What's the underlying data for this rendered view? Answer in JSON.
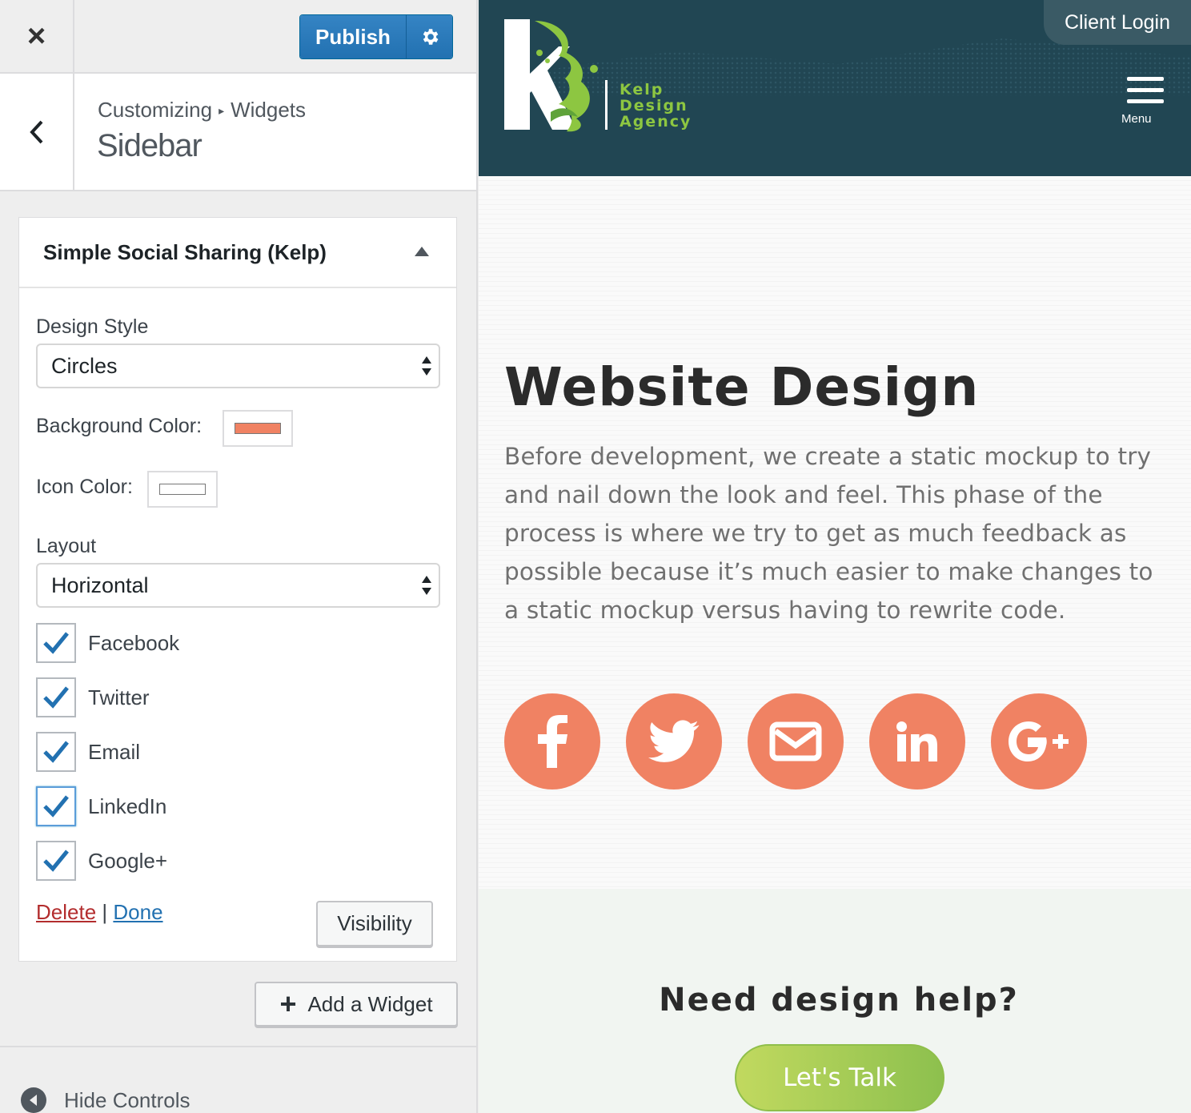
{
  "customizer": {
    "close_label": "×",
    "publish_label": "Publish",
    "breadcrumb": {
      "part1": "Customizing",
      "separator": "▸",
      "part2": "Widgets"
    },
    "section_title": "Sidebar",
    "widget": {
      "title": "Simple Social Sharing (Kelp)",
      "design_style": {
        "label": "Design Style",
        "value": "Circles"
      },
      "background_color": {
        "label": "Background Color:",
        "value": "#f08263"
      },
      "icon_color": {
        "label": "Icon Color:",
        "value": "#ffffff"
      },
      "layout": {
        "label": "Layout",
        "value": "Horizontal"
      },
      "networks": [
        {
          "label": "Facebook",
          "checked": true
        },
        {
          "label": "Twitter",
          "checked": true
        },
        {
          "label": "Email",
          "checked": true
        },
        {
          "label": "LinkedIn",
          "checked": true
        },
        {
          "label": "Google+",
          "checked": true
        }
      ],
      "delete_label": "Delete",
      "divider": "|",
      "done_label": "Done",
      "visibility_label": "Visibility"
    },
    "add_widget_label": "Add a Widget",
    "hide_controls_label": "Hide Controls"
  },
  "preview": {
    "client_login": "Client Login",
    "logo_text": [
      "Kelp",
      "Design",
      "Agency"
    ],
    "menu_label": "Menu",
    "heading": "Website Design",
    "paragraph": "Before development, we create a static mockup to try and nail down the look and feel. This phase of the process is where we try to get as much feedback as possible because it’s much easier to make changes to a static mockup versus having to rewrite code.",
    "social_icons": [
      "facebook-icon",
      "twitter-icon",
      "email-icon",
      "linkedin-icon",
      "google-plus-icon"
    ],
    "cta_title": "Need design help?",
    "cta_button": "Let's Talk"
  },
  "colors": {
    "header_bg": "#214653",
    "accent_green": "#8dc641",
    "social_bg": "#f08263",
    "wp_blue": "#2271b1"
  }
}
